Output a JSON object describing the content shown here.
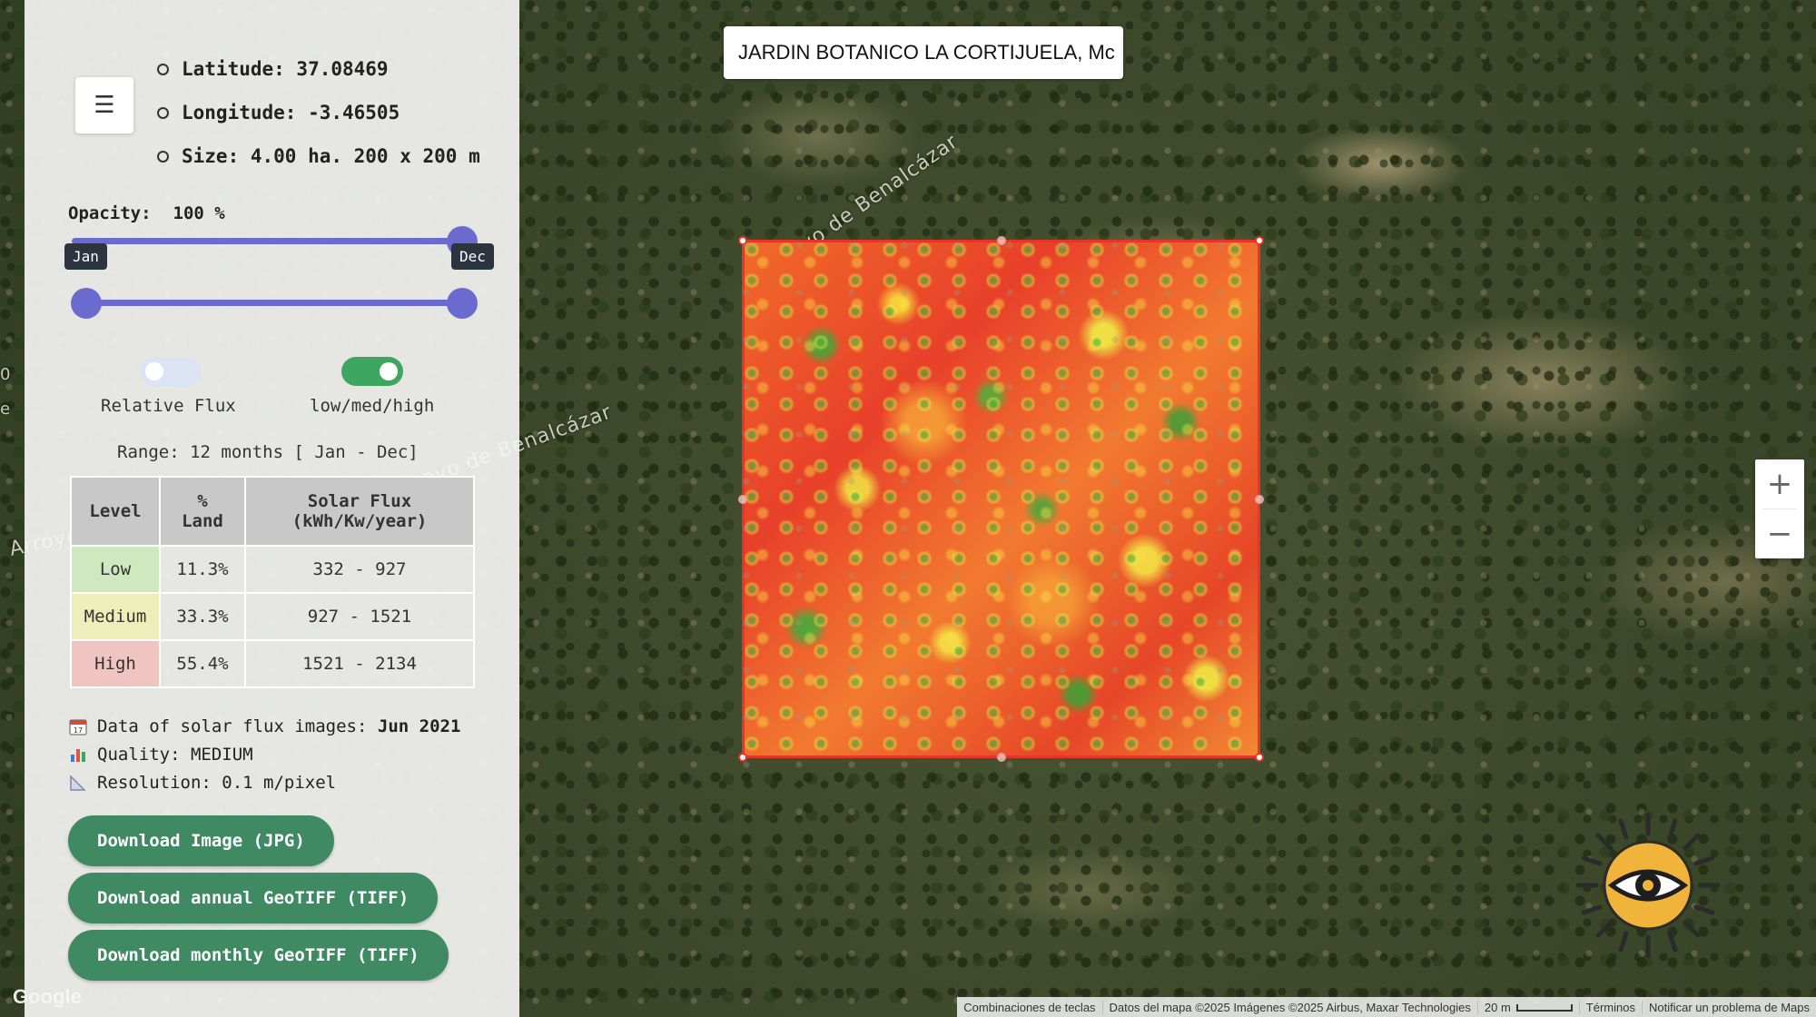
{
  "search": {
    "value": "JARDIN BOTANICO LA CORTIJUELA, Mc"
  },
  "location": {
    "latitude": "Latitude: 37.08469",
    "longitude": "Longitude: -3.46505",
    "size": "Size: 4.00 ha. 200 x 200 m"
  },
  "opacity": {
    "label": "Opacity:",
    "value": "100 %",
    "level_percent": 100
  },
  "month_range": {
    "start": "Jan",
    "end": "Dec"
  },
  "toggles": [
    {
      "label": "Relative Flux",
      "on": false
    },
    {
      "label": "low/med/high",
      "on": true
    }
  ],
  "range_text": "Range: 12 months [ Jan - Dec]",
  "table": {
    "headers": {
      "level": "Level",
      "land_pct": "%",
      "land_word": "Land",
      "flux": "Solar Flux",
      "flux_unit": "(kWh/Kw/year)"
    },
    "rows": [
      {
        "level": "Low",
        "pct": "11.3%",
        "range": "332 - 927",
        "color": "#cfe8c0"
      },
      {
        "level": "Medium",
        "pct": "33.3%",
        "range": "927 - 1521",
        "color": "#eeeebb"
      },
      {
        "level": "High",
        "pct": "55.4%",
        "range": "1521 - 2134",
        "color": "#f0c4c0"
      }
    ]
  },
  "meta": {
    "date_label": "Data of solar flux images:",
    "date_value": "Jun 2021",
    "quality": "Quality: MEDIUM",
    "resolution": "Resolution: 0.1 m/pixel"
  },
  "buttons": {
    "download_jpg": "Download Image (JPG)",
    "download_annual": "Download annual GeoTIFF (TIFF)",
    "download_monthly": "Download monthly GeoTIFF (TIFF)"
  },
  "map": {
    "road_label_1": "rroyo de Benalcázar",
    "road_label_2": "royo de Benalcázar",
    "road_label_3": "Arroyo",
    "edge_glyph_1": "0",
    "edge_glyph_2": "e",
    "google": "Google",
    "zoom_in": "+",
    "zoom_out": "−",
    "footer": {
      "shortcuts": "Combinaciones de teclas",
      "data": "Datos del mapa ©2025 Imágenes ©2025 Airbus, Maxar Technologies",
      "scale": "20 m",
      "terms": "Términos",
      "report": "Notificar un problema de Maps"
    }
  },
  "colors": {
    "accent": "#6b6bcf",
    "button_green": "#3f8a62",
    "toggle_on": "#3fa662",
    "overlay_border": "#e53527"
  },
  "icons": {
    "menu": "hamburger-icon",
    "calendar": "calendar-icon",
    "quality": "bar-chart-icon",
    "resolution": "ruler-icon",
    "logo": "solar-eye-logo"
  }
}
